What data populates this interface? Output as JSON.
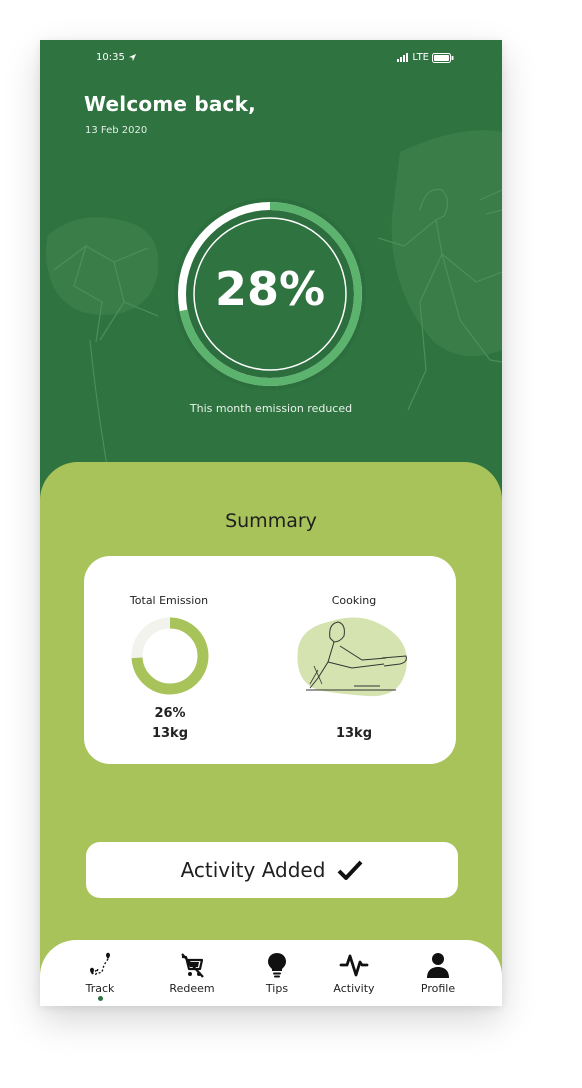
{
  "status_bar": {
    "time": "10:35",
    "network": "LTE"
  },
  "header": {
    "welcome": "Welcome back,",
    "date": "13 Feb 2020"
  },
  "progress": {
    "value_text": "28%",
    "fraction": 0.28,
    "caption": "This month emission reduced"
  },
  "summary": {
    "title": "Summary",
    "total_emission": {
      "label": "Total Emission",
      "percent": "26%",
      "amount": "13kg",
      "fraction": 0.26
    },
    "cooking": {
      "label": "Cooking",
      "amount": "13kg"
    }
  },
  "activity_button": {
    "label": "Activity Added"
  },
  "nav": {
    "items": [
      {
        "label": "Track",
        "icon": "route-map-icon",
        "active": true
      },
      {
        "label": "Redeem",
        "icon": "cart-off-icon"
      },
      {
        "label": "Tips",
        "icon": "lightbulb-icon"
      },
      {
        "label": "Activity",
        "icon": "activity-pulse-icon"
      },
      {
        "label": "Profile",
        "icon": "user-icon"
      }
    ]
  },
  "colors": {
    "hero_green": "#2f7341",
    "ring_green": "#5bb36d",
    "panel_green": "#a8c35a",
    "card_white": "#ffffff",
    "blob_green": "#d4e3b0"
  }
}
